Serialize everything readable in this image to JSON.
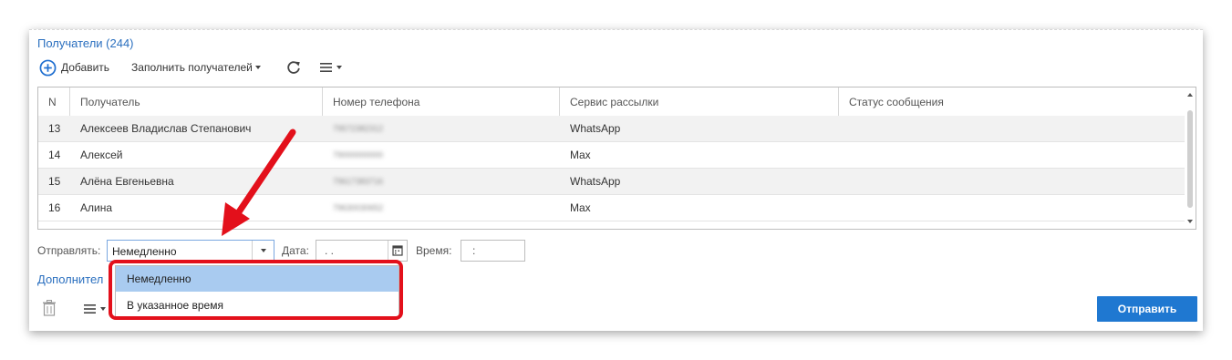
{
  "header": {
    "title": "Получатели (244)"
  },
  "toolbar": {
    "add_label": "Добавить",
    "fill_label": "Заполнить получателей"
  },
  "grid": {
    "columns": [
      "N",
      "Получатель",
      "Номер телефона",
      "Сервис рассылки",
      "Статус сообщения"
    ],
    "rows": [
      {
        "n": "13",
        "name": "Алексеев Владислав Степанович",
        "phone": "79572382312",
        "service": "WhatsApp",
        "status": ""
      },
      {
        "n": "14",
        "name": "Алексей",
        "phone": "79000000000",
        "service": "Max",
        "status": ""
      },
      {
        "n": "15",
        "name": "Алёна Евгеньевна",
        "phone": "79617383716",
        "service": "WhatsApp",
        "status": ""
      },
      {
        "n": "16",
        "name": "Алина",
        "phone": "79630030652",
        "service": "Max",
        "status": ""
      }
    ]
  },
  "send": {
    "label": "Отправлять:",
    "selected": "Немедленно",
    "date_label": "Дата:",
    "date_value": ". .",
    "time_label": "Время:",
    "time_value": ":"
  },
  "more_link": "Дополнител",
  "send_button": "Отправить",
  "dropdown": {
    "options": [
      "Немедленно",
      "В указанное время"
    ]
  },
  "colors": {
    "accent": "#1f78d1",
    "link": "#2a6fbf",
    "selected_option": "#a9cbf0",
    "annotation": "#e3101b"
  }
}
